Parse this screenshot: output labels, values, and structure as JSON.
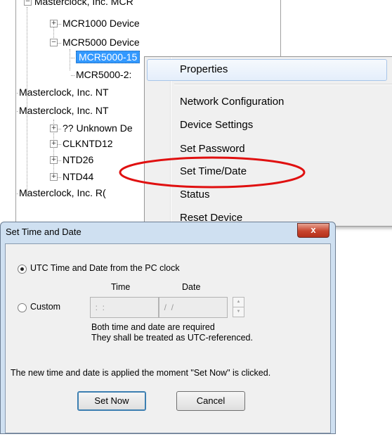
{
  "tree": {
    "items": [
      {
        "label": "Masterclock, Inc. MCR"
      },
      {
        "label": "MCR1000 Device"
      },
      {
        "label": "MCR5000 Device"
      },
      {
        "label": "MCR5000-15"
      },
      {
        "label": "MCR5000-2:"
      },
      {
        "label": "Masterclock, Inc. NT"
      },
      {
        "label": "Masterclock, Inc. NT"
      },
      {
        "label": "?? Unknown De"
      },
      {
        "label": "CLKNTD12"
      },
      {
        "label": "NTD26"
      },
      {
        "label": "NTD44"
      },
      {
        "label": "Masterclock, Inc. R("
      }
    ]
  },
  "context_menu": {
    "items": [
      {
        "label": "Properties"
      },
      {
        "label": "Network Configuration"
      },
      {
        "label": "Device Settings"
      },
      {
        "label": "Set Password"
      },
      {
        "label": "Set Time/Date"
      },
      {
        "label": "Status"
      },
      {
        "label": "Reset Device"
      }
    ],
    "highlighted_item": "Properties",
    "annotation_color": "#e01010"
  },
  "dialog": {
    "title": "Set Time and Date",
    "close_label": "x",
    "utc_option_label": "UTC Time and Date from the PC clock",
    "custom_option_label": "Custom",
    "selected_option": "utc",
    "time_header": "Time",
    "date_header": "Date",
    "time_value": "  :  :",
    "date_value": "  /  /",
    "note_line1": "Both time and date are required",
    "note_line2": "They shall be treated as UTC-referenced.",
    "info_text": "The new time and date is applied the moment  \"Set Now\" is clicked.",
    "set_now_label": "Set Now",
    "cancel_label": "Cancel",
    "colors": {
      "frame": "#cfe0f1",
      "close_button": "#c7442d"
    }
  }
}
